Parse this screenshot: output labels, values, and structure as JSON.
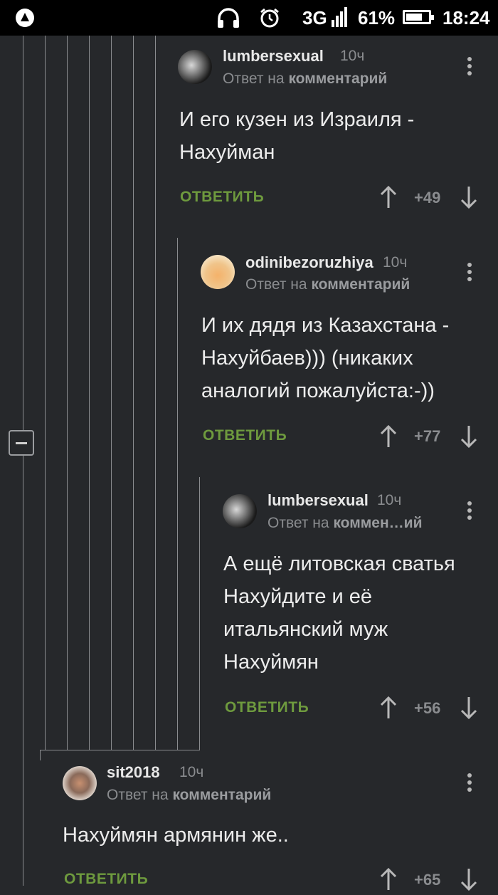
{
  "status_bar": {
    "signal": "3G",
    "battery_percent": "61%",
    "time": "18:24",
    "icons": [
      "app-icon",
      "headphones-icon",
      "alarm-icon",
      "signal-icon",
      "battery-icon"
    ]
  },
  "comments": [
    {
      "username": "lumbersexual",
      "time": "10ч",
      "reply_prefix": "Ответ на",
      "reply_target": "комментарий",
      "text_lines": [
        "И его кузен из Израиля -",
        "Нахуйман"
      ],
      "reply_label": "ОТВЕТИТЬ",
      "score": "+49"
    },
    {
      "username": "odinibezoruzhiya",
      "time": "10ч",
      "reply_prefix": "Ответ на",
      "reply_target": "комментарий",
      "text_lines": [
        "И их дядя из Казахстана -",
        "Нахуйбаев))) (никаких",
        "аналогий пожалуйста:-))"
      ],
      "reply_label": "ОТВЕТИТЬ",
      "score": "+77"
    },
    {
      "username": "lumbersexual",
      "time": "10ч",
      "reply_prefix": "Ответ на",
      "reply_target": "коммен…ий",
      "text_lines": [
        "А ещё литовская сватья",
        "Нахуйдите и её",
        "итальянский муж",
        "Нахуймян"
      ],
      "reply_label": "ОТВЕТИТЬ",
      "score": "+56"
    },
    {
      "username": "sit2018",
      "time": "10ч",
      "reply_prefix": "Ответ на",
      "reply_target": "комментарий",
      "text_lines": [
        "Нахуймян армянин же.."
      ],
      "reply_label": "ОТВЕТИТЬ",
      "score": "+65"
    }
  ],
  "colors": {
    "background": "#26282b",
    "reply": "#6e9a3e",
    "muted": "#8a8c8f",
    "text": "#ececec"
  }
}
